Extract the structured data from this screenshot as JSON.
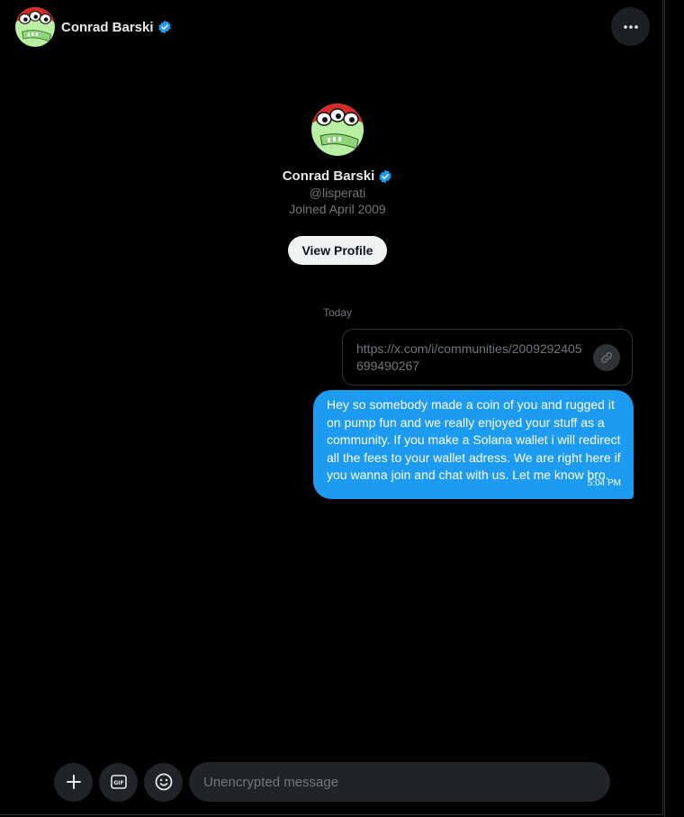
{
  "header": {
    "name": "Conrad Barski",
    "more_icon": "more-horizontal-icon"
  },
  "profile": {
    "name": "Conrad Barski",
    "handle": "@lisperati",
    "joined": "Joined April 2009",
    "view_profile_label": "View Profile"
  },
  "conversation": {
    "day_label": "Today",
    "link_card": {
      "url": "https://x.com/i/communities/2009292405699490267",
      "icon": "link-icon"
    },
    "message": {
      "text": "Hey so somebody made a coin of you and rugged it on pump fun and we really enjoyed your stuff as a community. If you make a Solana wallet i will redirect all the fees to your wallet adress. We are right here if you wanna join and chat with us. Let me know bro.",
      "time": "5:04 PM"
    }
  },
  "composer": {
    "placeholder": "Unencrypted message",
    "buttons": [
      "plus-icon",
      "gif-icon",
      "emoji-icon"
    ]
  },
  "colors": {
    "background": "#000000",
    "bubble": "#1d9bf0",
    "verified": "#1d9bf0",
    "secondary_text": "#71767b",
    "button_bg": "#202327"
  }
}
